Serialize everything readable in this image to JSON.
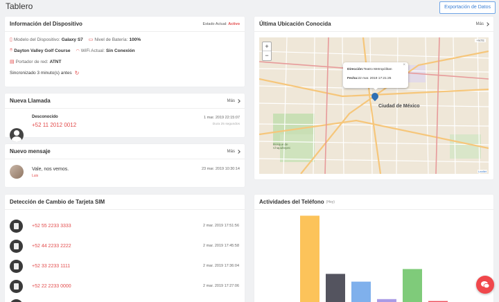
{
  "page_title": "Tablero",
  "export_label": "Exportación de Datos",
  "more_label": "Más",
  "device": {
    "title": "Información del Dispositivo",
    "status_label": "Estado Actual:",
    "status_value": "Activo",
    "model_label": "Modelo del Dispositivo:",
    "model_value": "Galaxy S7",
    "battery_label": "Nivel de Batería:",
    "battery_value": "100%",
    "location_value": "Dayton Valley Golf Course",
    "wifi_label": "WiFi Actual:",
    "wifi_value": "Sin Conexión",
    "carrier_label": "Portador de red:",
    "carrier_value": "ATNT",
    "sync_text": "Sincronizado 3 minuto(s) antes"
  },
  "location": {
    "title": "Última Ubicación Conocida",
    "zoom_in": "+",
    "zoom_out": "−",
    "popup_close": "×",
    "popup_address_label": "Dirección:",
    "popup_address_value": "Teatro Metropólitan",
    "popup_date_label": "Fecha:",
    "popup_date_value": "22 mar. 2019 17:21:25",
    "city_label": "Ciudad de México",
    "map_badge": "+NTE",
    "attribution": "Leaflet",
    "map_labels": [
      "Bosque de Chapultepec"
    ]
  },
  "call": {
    "title": "Nueva Llamada",
    "name": "Desconocido",
    "number": "+52 11 2012 0012",
    "date": "1 mar. 2019 22:15:07",
    "duration": "Dura 25 segundos"
  },
  "message": {
    "title": "Nuevo mensaje",
    "text": "Vale, nos vemos.",
    "sender": "Luis",
    "date": "23 mar. 2019 10:30:14"
  },
  "sim": {
    "title": "Detección de Cambio de Tarjeta SIM",
    "rows": [
      {
        "number": "+52 55 2233 3333",
        "date": "2 mar. 2019 17:51:56"
      },
      {
        "number": "+52 44 2233 2222",
        "date": "2 mar. 2019 17:45:58"
      },
      {
        "number": "+52 33 2233 1111",
        "date": "2 mar. 2019 17:36:04"
      },
      {
        "number": "+52 22 2233 0000",
        "date": "2 mar. 2019 17:27:06"
      }
    ]
  },
  "activity": {
    "title": "Actividades del Teléfono",
    "subtitle": "(Hoy)"
  },
  "chart_data": {
    "type": "bar",
    "title": "Actividades del Teléfono",
    "subtitle": "(Hoy)",
    "categories": [
      "",
      "",
      "",
      "",
      "",
      ""
    ],
    "values": [
      89,
      29,
      21,
      3,
      34,
      1
    ],
    "colors": [
      "#fcc35a",
      "#54545f",
      "#7fb0ec",
      "#a99be6",
      "#7fcb7a",
      "#ef4f5c"
    ],
    "ylim": [
      0,
      100
    ],
    "grid": false
  },
  "colors": {
    "accent": "#e24a4a",
    "link": "#3b7fd4",
    "fab": "#f0474b"
  }
}
